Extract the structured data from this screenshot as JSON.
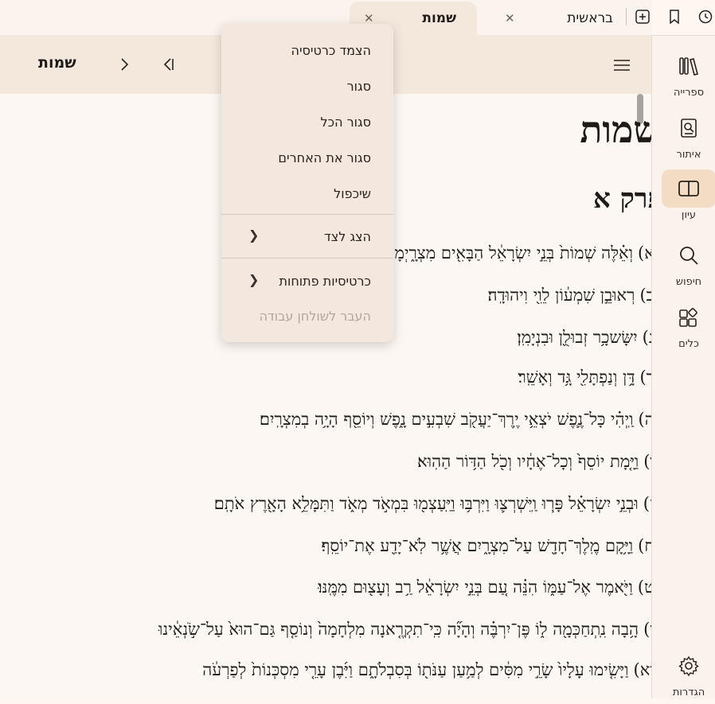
{
  "tabs": [
    {
      "label": "שמות",
      "active": true
    },
    {
      "label": "בראשית",
      "active": false
    }
  ],
  "toolbar": {
    "title": "שמות"
  },
  "nav": [
    {
      "label": "ספרייה",
      "icon": "library-icon"
    },
    {
      "label": "איתור",
      "icon": "locate-icon"
    },
    {
      "label": "עיון",
      "icon": "book-open-icon",
      "active": true
    },
    {
      "label": "חיפוש",
      "icon": "search-icon"
    },
    {
      "label": "כלים",
      "icon": "tools-icon"
    },
    {
      "label": "הגדרות",
      "icon": "gear-icon"
    }
  ],
  "content": {
    "book_title": "שמות",
    "chapter_title": "פרק א",
    "verses": [
      {
        "num": "(א)",
        "text": "וְאֵ֗לֶּה שְׁמוֹת֙ בְּנֵ֣י יִשְׂרָאֵ֔ל הַבָּאִ֖ים מִצְרָ֑יְמָה אֵ֣ת יַעֲקֹ֔ב אִ֥ישׁ וּבֵית֖וֹ בָּ֑אוּ׃"
      },
      {
        "num": "(ב)",
        "text": "רְאוּבֵ֣ן שִׁמְע֔וֹן לֵוִ֖י וִיהוּדָֽה׃"
      },
      {
        "num": "(ג)",
        "text": "יִשָּׂשכָ֥ר זְבוּלֻ֖ן וּבִנְיָמִֽן׃"
      },
      {
        "num": "(ד)",
        "text": "דָּ֥ן וְנַפְתָּלִ֖י גָּ֥ד וְאָשֵֽׁר׃"
      },
      {
        "num": "(ה)",
        "text": "וַֽיְהִ֗י כָּל־נֶ֛פֶשׁ יֹצְאֵ֥י יֶֽרֶךְ־יַעֲקֹ֖ב שִׁבְעִ֣ים נָ֑פֶשׁ וְיוֹסֵ֖ף הָיָ֥ה בְמִצְרָֽיִם׃"
      },
      {
        "num": "(ו)",
        "text": "וַיָּ֤מָת יוֹסֵף֙ וְכָל־אֶחָ֔יו וְכֹ֖ל הַדּ֥וֹר הַהֽוּא׃"
      },
      {
        "num": "(ז)",
        "text": "וּבְנֵ֣י יִשְׂרָאֵ֗ל פָּר֧וּ וַֽיִּשְׁרְצ֛וּ וַיִּרְבּ֥וּ וַיַּֽעַצְמ֖וּ בִּמְאֹ֣ד מְאֹ֑ד וַתִּמָּלֵ֥א הָאָ֖רֶץ אֹתָֽם׃"
      },
      {
        "num": "(ח)",
        "text": "וַיָּ֥קָם מֶֽלֶךְ־חָדָ֖שׁ עַל־מִצְרָ֑יִם אֲשֶׁ֥ר לֹֽא־יָדַ֖ע אֶת־יוֹסֵֽף׃"
      },
      {
        "num": "(ט)",
        "text": "וַיֹּ֖אמֶר אֶל־עַמּ֑וֹ הִנֵּ֗ה עַ֚ם בְּנֵ֣י יִשְׂרָאֵ֔ל רַ֥ב וְעָצ֖וּם מִמֶּֽנּוּ׃"
      },
      {
        "num": "(י)",
        "text": "הָ֥בָה נִֽתְחַכְּמָ֖ה ל֑וֹ פֶּן־יִרְבֶּ֗ה וְהָיָ֞ה כִּֽי־תִקְרֶ֤אנָה מִלְחָמָה֙ וְנוֹסַ֤ף גַּם־הוּא֙ עַל־שֹׂ֣נְאֵ֔ינוּ"
      },
      {
        "num": "(יא)",
        "text": "וַיָּשִׂ֤ימוּ עָלָיו֙ שָׂרֵ֣י מִסִּ֔ים לְמַ֥עַן עַנֹּת֖וֹ בְּסִבְלֹתָ֑ם וַיִּ֜בֶן עָרֵ֤י מִסְכְּנוֹת֙ לְפַרְעֹ֔ה"
      }
    ]
  },
  "menu": {
    "items": [
      {
        "label": "הצמד כרטיסיה",
        "disabled": false
      },
      {
        "label": "סגור",
        "disabled": false
      },
      {
        "label": "סגור הכל",
        "disabled": false
      },
      {
        "label": "סגור את האחרים",
        "disabled": false
      },
      {
        "label": "שיכפול",
        "disabled": false
      },
      {
        "label": "הצג לצד",
        "disabled": false,
        "submenu": true
      },
      {
        "label": "כרטיסיות פתוחות",
        "disabled": false,
        "submenu": true
      },
      {
        "label": "העבר לשולחן עבודה",
        "disabled": true
      }
    ]
  },
  "colors": {
    "accent": "#f2dcc4",
    "toolbar": "#f4e8dc",
    "background": "#fdf6f1"
  }
}
